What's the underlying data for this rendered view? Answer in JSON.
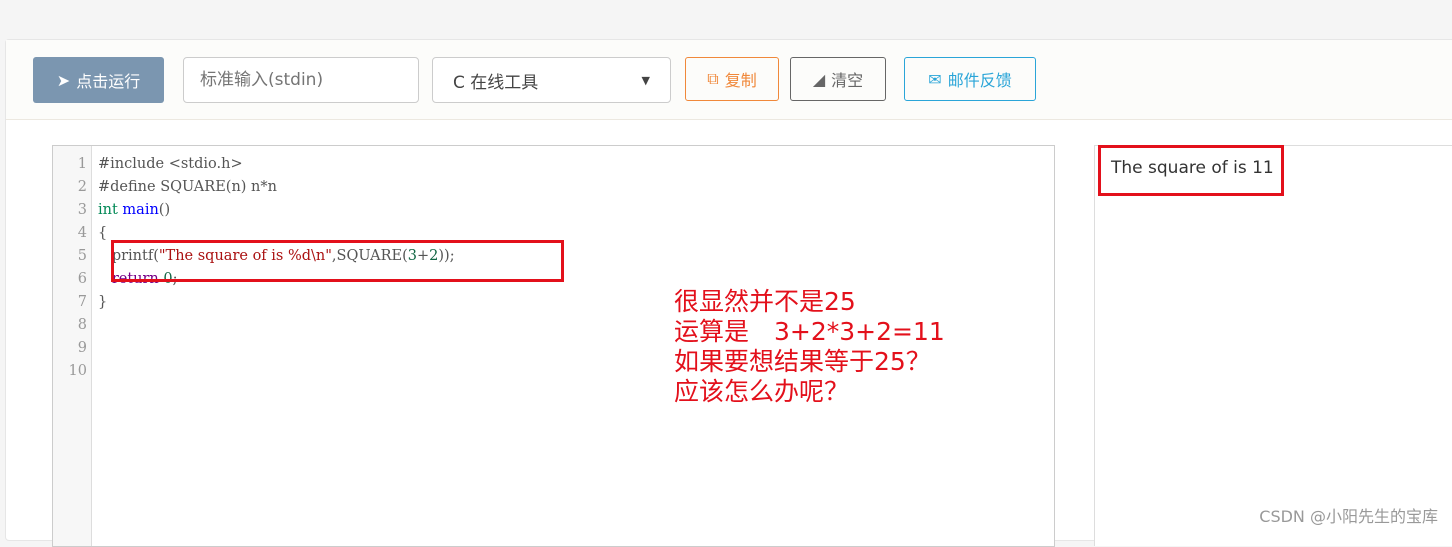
{
  "toolbar": {
    "run_label": "点击运行",
    "stdin_placeholder": "标准输入(stdin)",
    "language": "C 在线工具",
    "copy_label": "复制",
    "clear_label": "清空",
    "feedback_label": "邮件反馈"
  },
  "editor": {
    "line_numbers": [
      "1",
      "2",
      "3",
      "4",
      "5",
      "6",
      "7",
      "8",
      "9",
      "10"
    ],
    "lines": {
      "l1": "#include <stdio.h>",
      "l2": "#define SQUARE(n) n*n",
      "l3a": "int",
      "l3b": "main",
      "l3c": "()",
      "l4": "{",
      "l5a": "   printf(",
      "l5b": "\"The square of is %d\\n\"",
      "l5c": ",SQUARE(",
      "l5d": "3",
      "l5e": "+",
      "l5f": "2",
      "l5g": "));",
      "l6a": "   return",
      "l6b": " 0",
      "l6c": ";",
      "l7": "}"
    }
  },
  "output": {
    "text": "The square of is 11"
  },
  "annotation": {
    "lines": [
      "很显然并不是25",
      "运算是　3+2*3+2=11",
      "如果要想结果等于25？",
      "应该怎么办呢？"
    ],
    "color": "#e3101b"
  },
  "watermark": "CSDN @小阳先生的宝库"
}
